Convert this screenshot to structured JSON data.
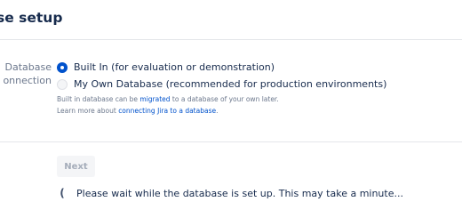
{
  "header": {
    "title": "se setup"
  },
  "form": {
    "field_label_line1": "Database",
    "field_label_line2": "onnection",
    "options": [
      {
        "label": "Built In (for evaluation or demonstration)",
        "selected": true
      },
      {
        "label": "My Own Database (recommended for production environments)",
        "selected": false
      }
    ],
    "help_line1_before": "Built in database can be ",
    "help_line1_link": "migrated",
    "help_line1_after": " to a database of your own later.",
    "help_line2_before": "Learn more about ",
    "help_line2_link": "connecting Jira to a database",
    "help_line2_after": "."
  },
  "actions": {
    "next_label": "Next",
    "next_enabled": false
  },
  "status": {
    "spinner_glyph": "(",
    "wait_message": "Please wait while the database is set up. This may take a minute..."
  },
  "colors": {
    "accent": "#0052cc",
    "text": "#172b4d",
    "subtle_text": "#6b778c",
    "disabled_bg": "#f4f5f7",
    "disabled_text": "#a5adba"
  }
}
